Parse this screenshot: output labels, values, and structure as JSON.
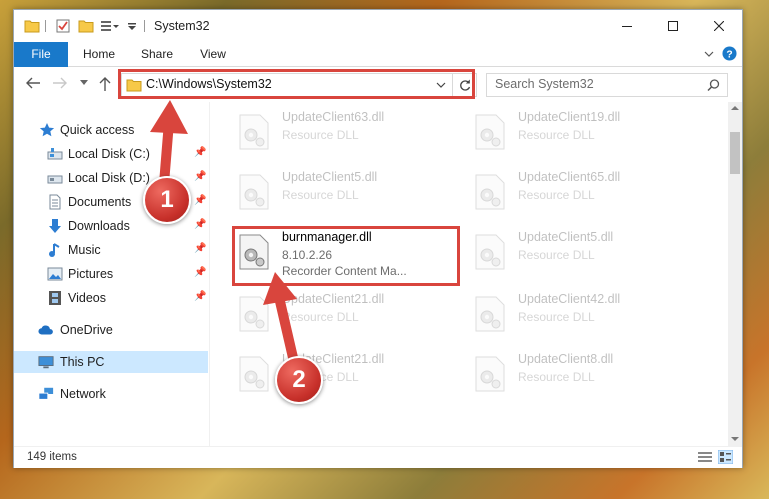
{
  "window": {
    "title": "System32"
  },
  "ribbon": {
    "tabs": [
      "File",
      "Home",
      "Share",
      "View"
    ]
  },
  "address": {
    "path": "C:\\Windows\\System32"
  },
  "search": {
    "placeholder": "Search System32"
  },
  "nav": {
    "quick_access": "Quick access",
    "items": [
      "Local Disk (C:)",
      "Local Disk (D:)",
      "Documents",
      "Downloads",
      "Music",
      "Pictures",
      "Videos"
    ],
    "onedrive": "OneDrive",
    "this_pc": "This PC",
    "network": "Network"
  },
  "files": [
    {
      "name": "UpdateClient63.dll",
      "type": "Resource DLL"
    },
    {
      "name": "UpdateClient19.dll",
      "type": "Resource DLL"
    },
    {
      "name": "UpdateClient5.dll",
      "type": "Resource DLL"
    },
    {
      "name": "UpdateClient65.dll",
      "type": "Resource DLL"
    },
    {
      "name": "burnmanager.dll",
      "version": "8.10.2.26",
      "type": "Recorder Content Ma..."
    },
    {
      "name": "UpdateClient5.dll",
      "type": "Resource DLL"
    },
    {
      "name": "UpdateClient21.dll",
      "type": "Resource DLL"
    },
    {
      "name": "UpdateClient42.dll",
      "type": "Resource DLL"
    },
    {
      "name": "UpdateClient21.dll",
      "type": "Resource DLL"
    },
    {
      "name": "UpdateClient8.dll",
      "type": "Resource DLL"
    }
  ],
  "status": {
    "count": "149 items"
  },
  "annotations": {
    "step1": "1",
    "step2": "2"
  },
  "colors": {
    "accent": "#1979ca",
    "highlight": "#d9453d",
    "selected": "#cce8ff"
  }
}
